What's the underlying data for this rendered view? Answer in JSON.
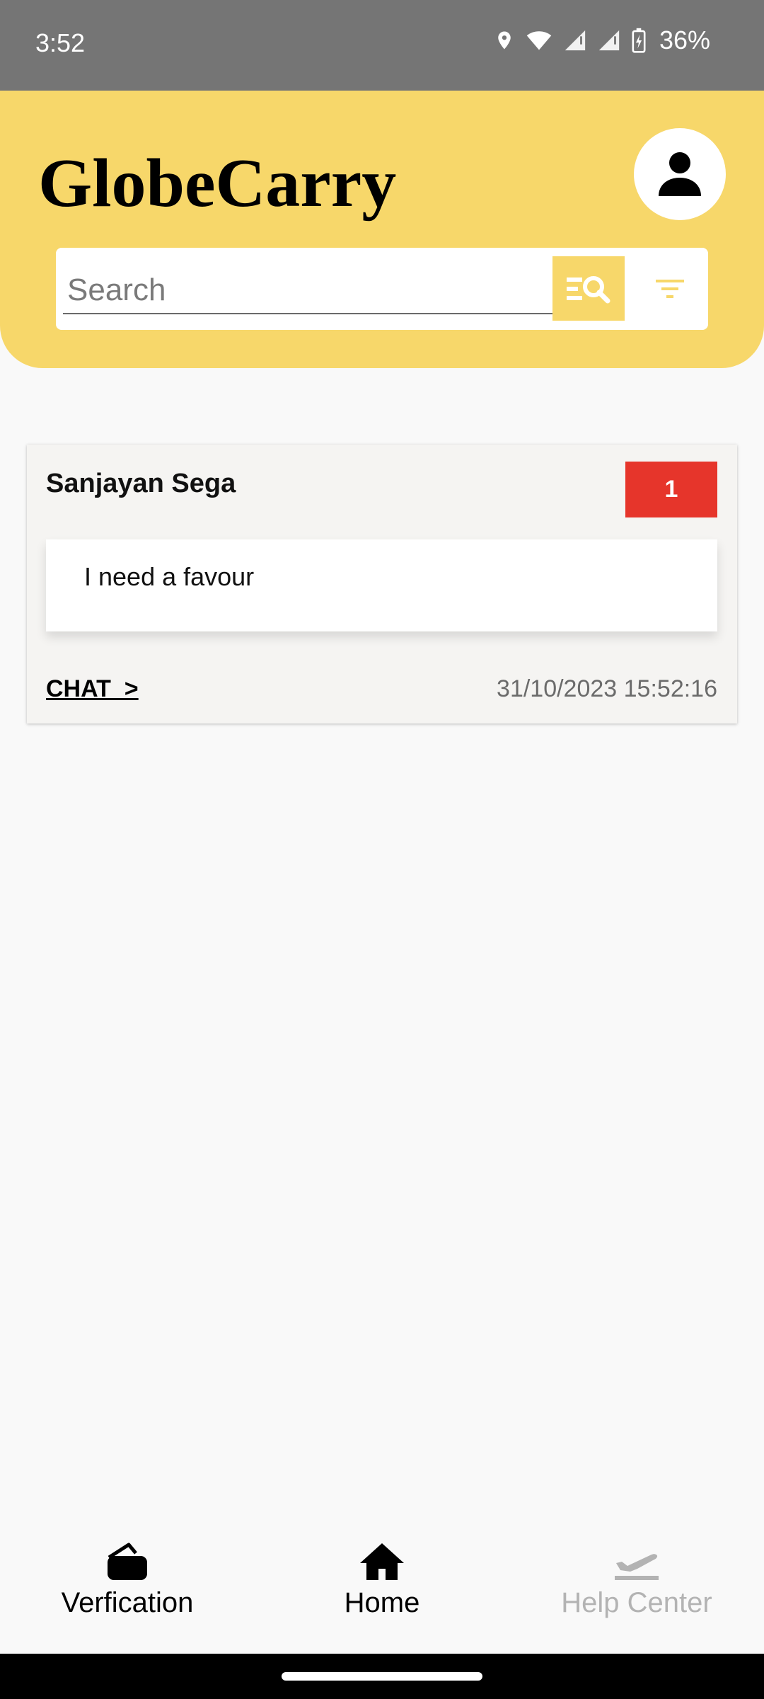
{
  "status_bar": {
    "time": "3:52",
    "battery": "36%"
  },
  "header": {
    "app_title": "GlobeCarry",
    "search_placeholder": "Search",
    "accent_color": "#f7d76a"
  },
  "messages": [
    {
      "sender": "Sanjayan Sega",
      "unread_count": "1",
      "text": "I need a favour",
      "action_label": "CHAT  >",
      "timestamp": "31/10/2023 15:52:16"
    }
  ],
  "bottom_nav": {
    "items": [
      {
        "label": "Verfication",
        "icon": "wallet-icon"
      },
      {
        "label": "Home",
        "icon": "home-icon"
      },
      {
        "label": "Help Center",
        "icon": "plane-icon"
      }
    ]
  },
  "colors": {
    "badge": "#e6352b",
    "status_bar": "#757575"
  }
}
